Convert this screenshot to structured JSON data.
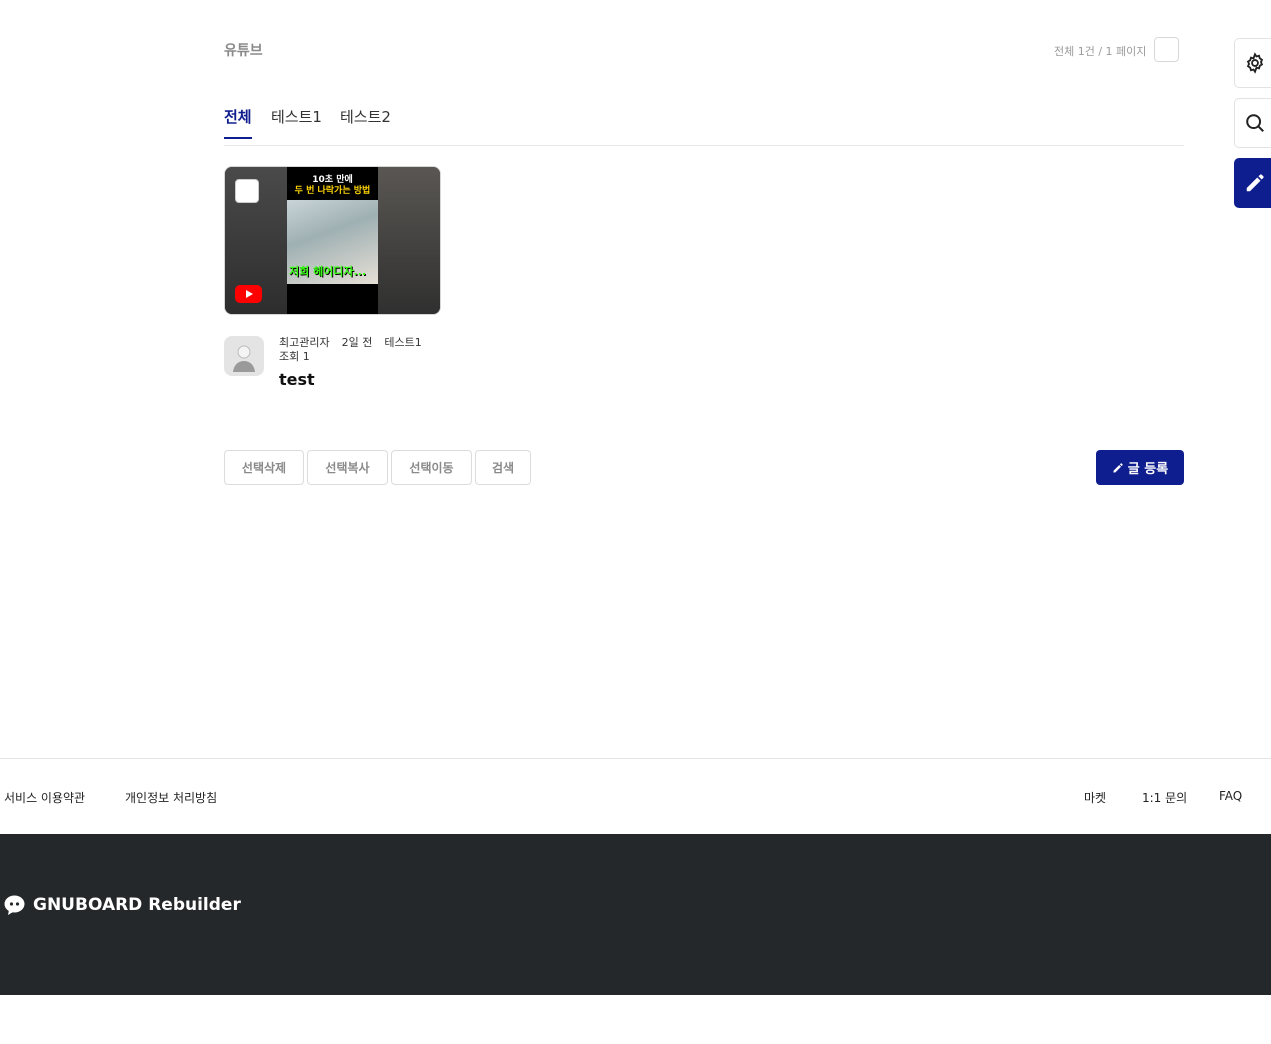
{
  "board": {
    "title": "유튜브",
    "count_text": "전체 1건 / 1 페이지"
  },
  "side_buttons": {
    "settings_icon": "gear-icon",
    "search_icon": "search-icon",
    "write_icon": "pencil-icon"
  },
  "tabs": [
    {
      "label": "전체",
      "active": true
    },
    {
      "label": "테스트1",
      "active": false
    },
    {
      "label": "테스트2",
      "active": false
    }
  ],
  "post": {
    "thumbnail": {
      "caption_line1": "10초 만에",
      "caption_line2": "두 번 나락가는 방법",
      "overlay_text": "저희 헤어디자...",
      "play_icon": "youtube-play-icon"
    },
    "author": "최고관리자",
    "date": "2일 전",
    "category": "테스트1",
    "views": "조회 1",
    "title": "test"
  },
  "actions": {
    "delete": "선택삭제",
    "copy": "선택복사",
    "move": "선택이동",
    "search": "검색",
    "write": "글 등록"
  },
  "footer": {
    "terms": "서비스 이용약관",
    "privacy": "개인정보 처리방침",
    "market": "마켓",
    "inquiry": "1:1 문의",
    "faq": "FAQ",
    "logo_text": "GNUBOARD Rebuilder"
  },
  "colors": {
    "accent": "#0f1e8e",
    "footer_bg": "#25282b"
  }
}
